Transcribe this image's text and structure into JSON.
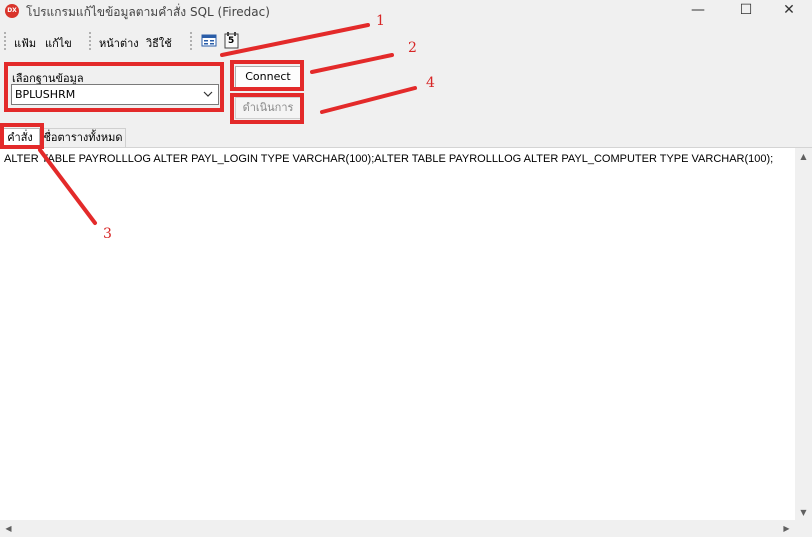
{
  "window": {
    "title": "โปรแกรมแก้ไขข้อมูลตามคำสั่ง SQL (Firedac)",
    "app_icon_text": "DX",
    "controls": {
      "minimize": "—",
      "maximize": "☐",
      "close": "✕"
    }
  },
  "menu": {
    "items": [
      {
        "label": "แฟ้ม"
      },
      {
        "label": "แก้ไข"
      },
      {
        "label": "หน้าต่าง"
      },
      {
        "label": "วิธีใช้"
      }
    ],
    "toolbar_icons": [
      "window-icon",
      "calendar-icon"
    ],
    "calendar_icon_text": "5"
  },
  "database": {
    "label": "เลือกฐานข้อมูล",
    "selected": "BPLUSHRM"
  },
  "buttons": {
    "connect": "Connect",
    "execute": "ดำเนินการ"
  },
  "tabs": [
    {
      "label": "คำสั่ง",
      "active": true
    },
    {
      "label": "ชื่อตารางทั้งหมด",
      "active": false
    }
  ],
  "editor": {
    "sql": "ALTER TABLE PAYROLLLOG ALTER PAYL_LOGIN TYPE VARCHAR(100);ALTER TABLE PAYROLLLOG ALTER PAYL_COMPUTER TYPE VARCHAR(100);"
  },
  "annotations": {
    "color": "#e32a2a",
    "callouts": [
      "1",
      "2",
      "3",
      "4"
    ]
  }
}
